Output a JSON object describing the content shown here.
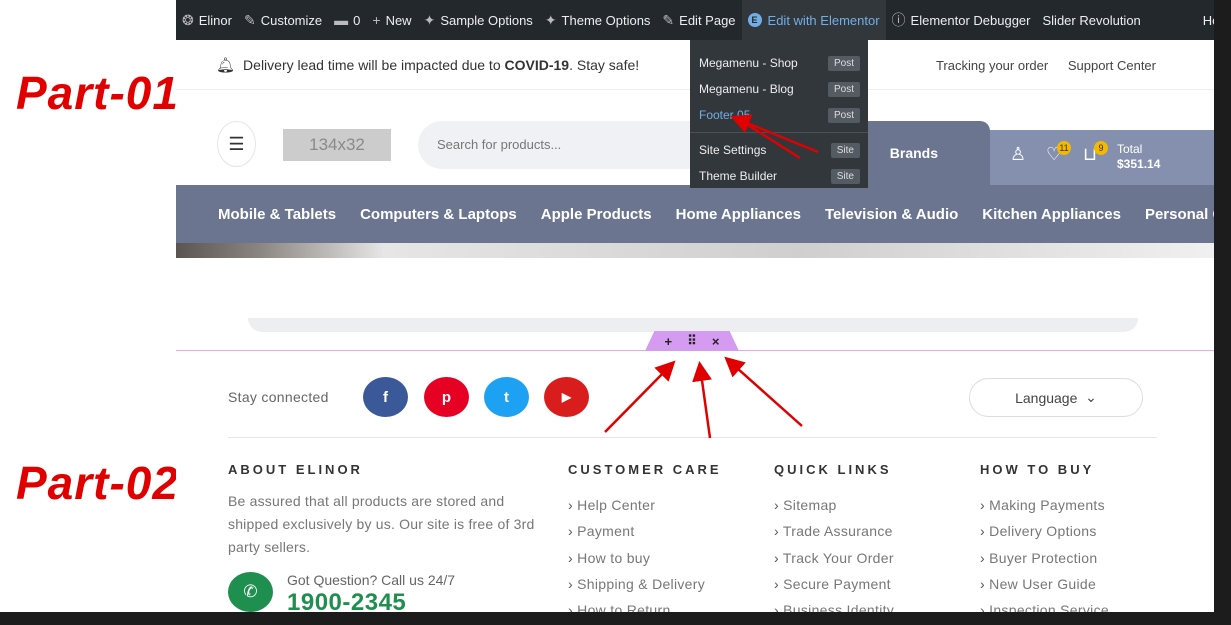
{
  "annotations": {
    "part1": "Part-01",
    "part2": "Part-02"
  },
  "adminbar": {
    "items": [
      "Elinor",
      "Customize",
      "0",
      "New",
      "Sample Options",
      "Theme Options",
      "Edit Page",
      "Edit with Elementor",
      "Elementor Debugger",
      "Slider Revolution"
    ],
    "howdy": "Howdy,"
  },
  "dropdown": {
    "rows": [
      {
        "label": "Megamenu - Shop",
        "badge": "Post"
      },
      {
        "label": "Megamenu - Blog",
        "badge": "Post"
      },
      {
        "label": "Footer 05",
        "badge": "Post"
      },
      {
        "label": "Site Settings",
        "badge": "Site"
      },
      {
        "label": "Theme Builder",
        "badge": "Site"
      }
    ]
  },
  "notice": {
    "text_before": "Delivery lead time will be impacted due to ",
    "bold": "COVID-19",
    "text_after": ". Stay safe!",
    "tracking": "Tracking your order",
    "support": "Support Center"
  },
  "header": {
    "logo": "134x32",
    "search_placeholder": "Search for products...",
    "brands": "Brands",
    "wishlist_count": "11",
    "cart_count": "9",
    "total_label": "Total",
    "total_value": "$351.14"
  },
  "nav": [
    "Mobile & Tablets",
    "Computers & Laptops",
    "Apple Products",
    "Home Appliances",
    "Television & Audio",
    "Kitchen Appliances",
    "Personal Care"
  ],
  "handle": {
    "add": "+",
    "move": "⠿",
    "close": "×"
  },
  "footer": {
    "stay": "Stay connected",
    "social": [
      "f",
      "p",
      "t",
      "▶"
    ],
    "language": "Language",
    "about_title": "ABOUT ELINOR",
    "about_text": "Be assured that all products are stored and shipped exclusively by us. Our site is free of 3rd party sellers.",
    "got_question": "Got Question? Call us 24/7",
    "phone": "1900-2345",
    "customer_title": "CUSTOMER CARE",
    "customer_links": [
      "Help Center",
      "Payment",
      "How to buy",
      "Shipping & Delivery",
      "How to Return"
    ],
    "quick_title": "QUICK LINKS",
    "quick_links": [
      "Sitemap",
      "Trade Assurance",
      "Track Your Order",
      "Secure Payment",
      "Business Identity"
    ],
    "buy_title": "HOW TO BUY",
    "buy_links": [
      "Making Payments",
      "Delivery Options",
      "Buyer Protection",
      "New User Guide",
      "Inspection Service"
    ]
  },
  "colors": {
    "adminbar": "#23282d",
    "nav": "#6b7590",
    "accent_green": "#1f8f4f",
    "annotation_red": "#e00000",
    "facebook": "#3b5998",
    "pinterest": "#e60023",
    "twitter": "#1da1f2",
    "youtube": "#d91c1c"
  }
}
